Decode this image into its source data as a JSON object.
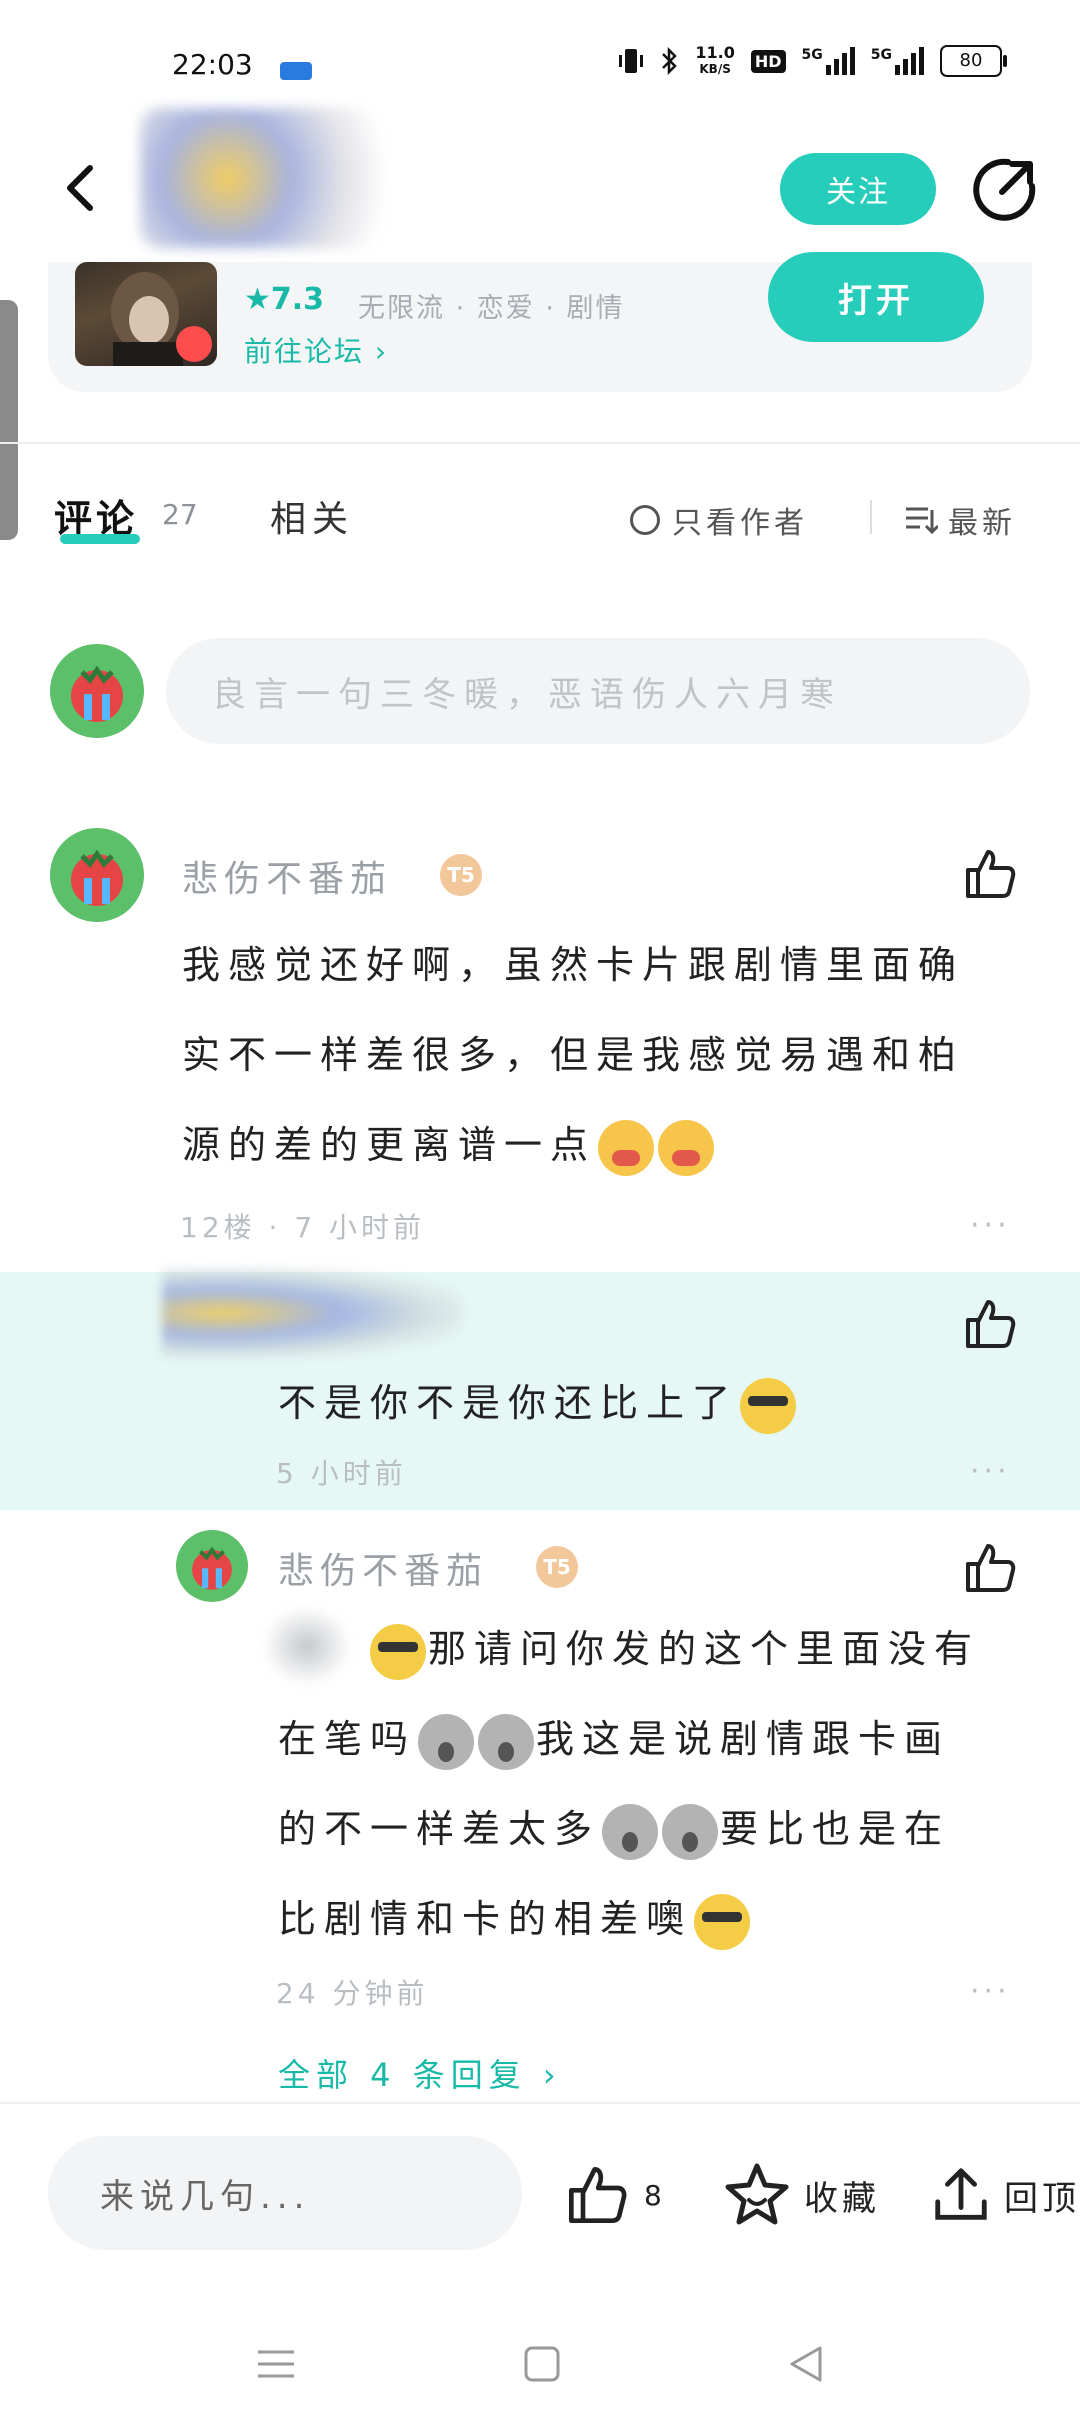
{
  "status_bar": {
    "time": "22:03",
    "net_speed_value": "11.0",
    "net_speed_unit": "KB/S",
    "hd_label": "HD",
    "signal1_label": "5G",
    "signal2_label": "5G",
    "battery": "80"
  },
  "header": {
    "follow_label": "关注"
  },
  "game": {
    "rating": "7.3",
    "tags": "无限流 · 恋爱 · 剧情",
    "forum_link": "前往论坛",
    "open_label": "打开"
  },
  "tabs": {
    "comments_label": "评论",
    "comments_count": "27",
    "related_label": "相关",
    "only_author_label": "只看作者",
    "sort_label": "最新"
  },
  "comment_input": {
    "placeholder": "良言一句三冬暖，恶语伤人六月寒"
  },
  "comments": [
    {
      "author": "悲伤不番茄",
      "badge": "T5",
      "text_line1": "我感觉还好啊，虽然卡片跟剧情里面确",
      "text_line2": "实不一样差很多，但是我感觉易遇和柏",
      "text_line3": "源的差的更离谱一点",
      "floor": "12楼",
      "time": "7 小时前"
    }
  ],
  "replies": [
    {
      "text": "不是你不是你还比上了",
      "time": "5 小时前"
    },
    {
      "author": "悲伤不番茄",
      "badge": "T5",
      "text_line1": "那请问你发的这个里面没有",
      "text_line2": "在笔吗",
      "text_line2b": "我这是说剧情跟卡画",
      "text_line3": "的不一样差太多",
      "text_line3b": "要比也是在",
      "text_line4": "比剧情和卡的相差噢",
      "time": "24 分钟前"
    }
  ],
  "all_replies_label": "全部 4 条回复 ›",
  "more_label": "···",
  "bottom_bar": {
    "say_placeholder": "来说几句...",
    "like_count": "8",
    "favorite_label": "收藏",
    "top_label": "回顶"
  },
  "colors": {
    "accent": "#26cdbb",
    "highlight_bg": "#e6f8f6"
  }
}
